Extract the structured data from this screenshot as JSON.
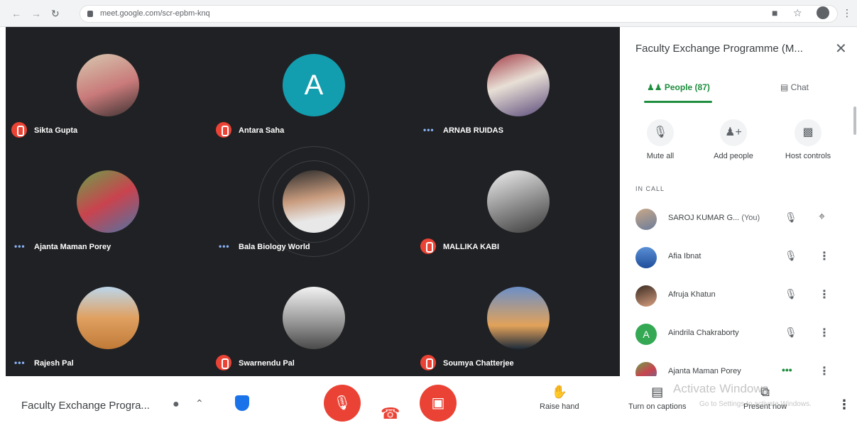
{
  "browser": {
    "url": "meet.google.com/scr-epbm-knq",
    "icons": [
      "back-icon",
      "forward-icon",
      "reload-icon",
      "lock-icon",
      "camera-icon",
      "star-icon",
      "profile-icon",
      "menu-icon"
    ]
  },
  "colors": {
    "grid_bg": "#202124",
    "mic_off": "#ea4335",
    "accent_green": "#1e8e3e",
    "speaking_dots": "#8ab4f8"
  },
  "tiles": [
    {
      "name": "Sikta Gupta",
      "status": "muted",
      "avatar": "photo"
    },
    {
      "name": "Antara Saha",
      "status": "muted",
      "avatar": "letter",
      "letter": "A"
    },
    {
      "name": "ARNAB RUIDAS",
      "status": "speaking",
      "avatar": "photo"
    },
    {
      "name": "Ajanta Maman Porey",
      "status": "speaking",
      "avatar": "photo"
    },
    {
      "name": "Bala Biology World",
      "status": "speaking",
      "avatar": "photo"
    },
    {
      "name": "MALLIKA KABI",
      "status": "muted",
      "avatar": "photo"
    },
    {
      "name": "Rajesh Pal",
      "status": "speaking",
      "avatar": "photo"
    },
    {
      "name": "Swarnendu Pal",
      "status": "muted",
      "avatar": "photo"
    },
    {
      "name": "Soumya Chatterjee",
      "status": "muted",
      "avatar": "photo"
    }
  ],
  "panel": {
    "title": "Faculty Exchange Programme (M...",
    "close_icon": "close-icon",
    "tabs": [
      {
        "label": "People (87)",
        "icon": "people-icon",
        "active": true
      },
      {
        "label": "Chat",
        "icon": "chat-icon",
        "active": false
      }
    ],
    "actions": [
      {
        "label": "Mute all",
        "icon": "mic-off-icon"
      },
      {
        "label": "Add people",
        "icon": "add-person-icon"
      },
      {
        "label": "Host controls",
        "icon": "toggle-icon"
      }
    ],
    "section_label": "IN CALL",
    "people": [
      {
        "name": "SAROJ KUMAR G...",
        "suffix": "(You)",
        "avatar": "photo",
        "mute_icon": "mic-off-icon",
        "right_icon": "pin-icon"
      },
      {
        "name": "Afia Ibnat",
        "suffix": "",
        "avatar": "photo",
        "mute_icon": "mic-off-icon",
        "right_icon": "more-vert-icon"
      },
      {
        "name": "Afruja Khatun",
        "suffix": "",
        "avatar": "photo",
        "mute_icon": "mic-off-icon",
        "right_icon": "more-vert-icon"
      },
      {
        "name": "Aindrila Chakraborty",
        "suffix": "",
        "avatar": "letter",
        "letter": "A",
        "mute_icon": "mic-off-icon",
        "right_icon": "more-vert-icon"
      },
      {
        "name": "Ajanta Maman Porey",
        "suffix": "",
        "avatar": "photo",
        "mute_icon": "speaking-dots",
        "right_icon": "more-vert-icon"
      }
    ]
  },
  "bottom": {
    "meeting_title": "Faculty Exchange Progra...",
    "raise_hand": "Raise hand",
    "captions": "Turn on captions",
    "present": "Present now",
    "watermark_title": "Activate Windows",
    "watermark_sub": "Go to Settings to activate Windows."
  }
}
